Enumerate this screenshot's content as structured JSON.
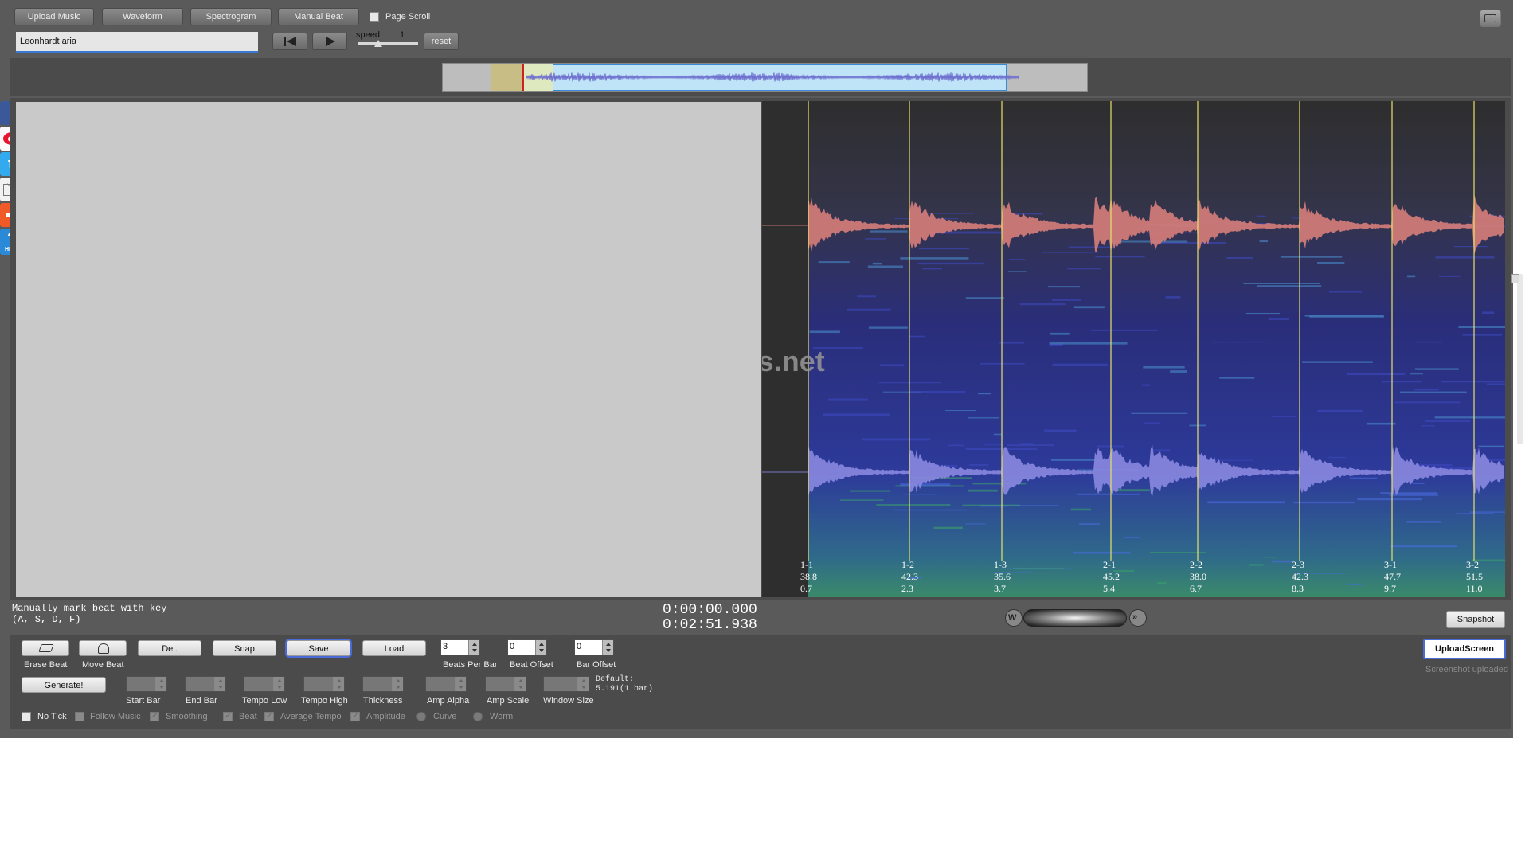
{
  "toolbar": {
    "upload_music": "Upload Music",
    "waveform": "Waveform",
    "spectrogram": "Spectrogram",
    "manual_beat": "Manual Beat",
    "page_scroll": "Page Scroll"
  },
  "song": {
    "title": "Leonhardt aria"
  },
  "playback": {
    "speed_label": "speed",
    "speed_value": "1",
    "reset": "reset"
  },
  "share_icons": [
    "facebook-icon",
    "weibo-icon",
    "twitter-icon",
    "email-icon",
    "add-more-icon",
    "help-icon"
  ],
  "watermark": "www.Vmus.net",
  "beats": [
    {
      "id": "1-1",
      "tempo": "38.8",
      "time": "0.7"
    },
    {
      "id": "1-2",
      "tempo": "42.3",
      "time": "2.3"
    },
    {
      "id": "1-3",
      "tempo": "35.6",
      "time": "3.7"
    },
    {
      "id": "2-1",
      "tempo": "45.2",
      "time": "5.4"
    },
    {
      "id": "2-2",
      "tempo": "38.0",
      "time": "6.7"
    },
    {
      "id": "2-3",
      "tempo": "42.3",
      "time": "8.3"
    },
    {
      "id": "3-1",
      "tempo": "47.7",
      "time": "9.7"
    },
    {
      "id": "3-2",
      "tempo": "51.5",
      "time": "11.0"
    }
  ],
  "status": {
    "hint_line1": "Manually mark beat with key",
    "hint_line2": "(A, S, D, F)",
    "current_time": "0:00:00.000",
    "total_time": "0:02:51.938",
    "snapshot": "Snapshot",
    "upload_screen": "UploadScreen",
    "screenshot_uploaded": "Screenshot uploaded"
  },
  "controls": {
    "erase_beat": "Erase Beat",
    "move_beat": "Move Beat",
    "del": "Del.",
    "snap": "Snap",
    "save": "Save",
    "load": "Load",
    "beats_per_bar_label": "Beats Per Bar",
    "beats_per_bar_value": "3",
    "beat_offset_label": "Beat Offset",
    "beat_offset_value": "0",
    "bar_offset_label": "Bar Offset",
    "bar_offset_value": "0",
    "generate": "Generate!",
    "start_bar": "Start Bar",
    "end_bar": "End Bar",
    "tempo_low": "Tempo Low",
    "tempo_high": "Tempo High",
    "thickness": "Thickness",
    "amp_alpha": "Amp Alpha",
    "amp_scale": "Amp Scale",
    "window_size": "Window Size",
    "default_line1": "Default:",
    "default_line2": "5.191(1 bar)",
    "no_tick": "No Tick",
    "follow_music": "Follow Music",
    "smoothing": "Smoothing",
    "beat": "Beat",
    "average_tempo": "Average Tempo",
    "amplitude": "Amplitude",
    "curve": "Curve",
    "worm": "Worm"
  },
  "colors": {
    "app_bg": "#5a5a5a",
    "panel_bg": "#4b4b4b",
    "beat_line": "#e8e06a",
    "waveform_top": "#d07a78",
    "waveform_bottom": "#8a88e0",
    "overview_selection": "#bfe4f8"
  }
}
